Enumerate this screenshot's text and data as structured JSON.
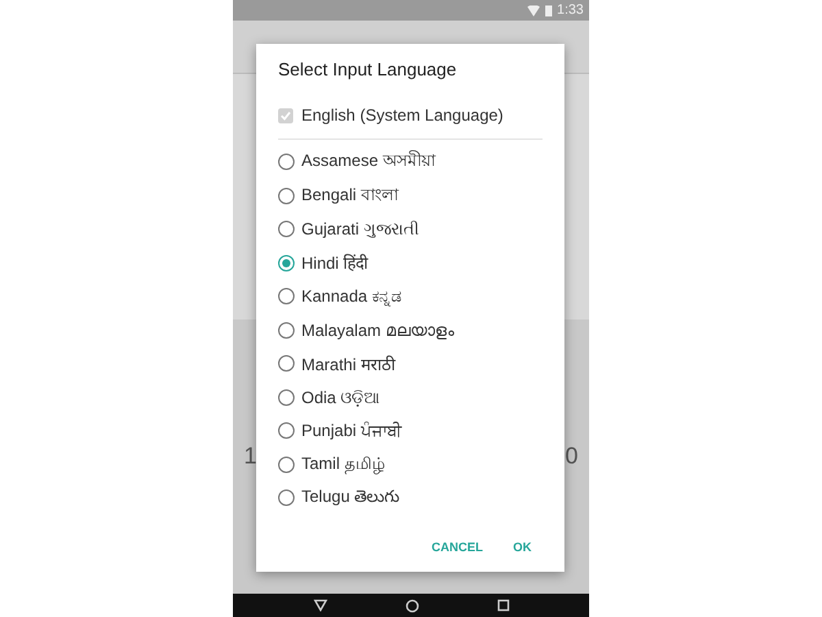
{
  "status_bar": {
    "time": "1:33"
  },
  "keyboard": {
    "left_key": "1",
    "right_key": "0"
  },
  "dialog": {
    "title": "Select Input Language",
    "system_language": {
      "label": "English (System Language)",
      "checked": true,
      "disabled": true
    },
    "options": [
      {
        "label": "Assamese অসমীয়া",
        "selected": false
      },
      {
        "label": "Bengali বাংলা",
        "selected": false
      },
      {
        "label": "Gujarati ગુજરાતી",
        "selected": false
      },
      {
        "label": "Hindi हिंदी",
        "selected": true
      },
      {
        "label": "Kannada ಕನ್ನಡ",
        "selected": false
      },
      {
        "label": "Malayalam മലയാളം",
        "selected": false
      },
      {
        "label": "Marathi मराठी",
        "selected": false
      },
      {
        "label": "Odia ଓଡ଼ିଆ",
        "selected": false
      },
      {
        "label": "Punjabi ਪੰਜਾਬੀ",
        "selected": false
      },
      {
        "label": "Tamil தமிழ்",
        "selected": false
      },
      {
        "label": "Telugu తెలుగు",
        "selected": false
      }
    ],
    "buttons": [
      "CANCEL",
      "OK"
    ]
  }
}
